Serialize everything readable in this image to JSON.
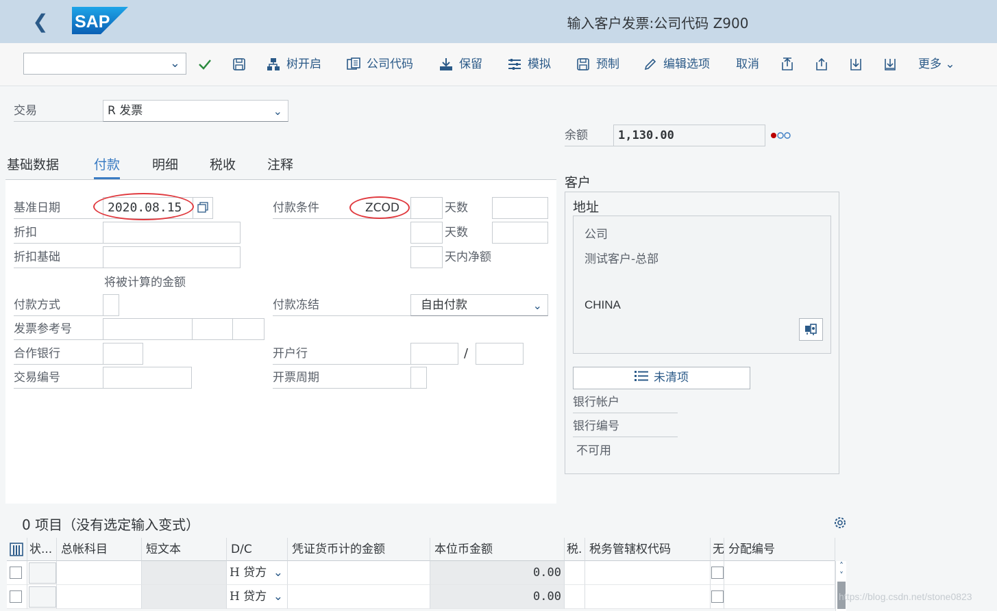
{
  "header": {
    "title": "输入客户发票:公司代码 Z900",
    "logo_text": "SAP"
  },
  "toolbar": {
    "dropdown_value": "",
    "tree_label": "树开启",
    "company_code_label": "公司代码",
    "hold_label": "保留",
    "simulate_label": "模拟",
    "park_label": "预制",
    "edit_options_label": "编辑选项",
    "cancel_label": "取消",
    "more_label": "更多"
  },
  "transaction": {
    "label": "交易",
    "value": "R 发票"
  },
  "balance": {
    "label": "余额",
    "value": "1,130.00"
  },
  "tabs": [
    {
      "label": "基础数据"
    },
    {
      "label": "付款"
    },
    {
      "label": "明细"
    },
    {
      "label": "税收"
    },
    {
      "label": "注释"
    }
  ],
  "payment": {
    "baseline_date_label": "基准日期",
    "baseline_date_value": "2020.08.15",
    "discount_label": "折扣",
    "discount_base_label": "折扣基础",
    "amount_to_calc": "将被计算的金额",
    "payment_method_label": "付款方式",
    "invoice_ref_label": "发票参考号",
    "partner_bank_label": "合作银行",
    "transaction_no_label": "交易编号",
    "payment_terms_label": "付款条件",
    "payment_terms_value": "ZCOD",
    "days_label_1": "天数",
    "days_label_2": "天数",
    "net_days_label": "天内净额",
    "payment_block_label": "付款冻结",
    "payment_block_value": "自由付款",
    "house_bank_label": "开户行",
    "slash": "/",
    "invoice_cycle_label": "开票周期"
  },
  "customer": {
    "section_label": "客户",
    "address_label": "地址",
    "line1": "公司",
    "line2": "测试客户-总部",
    "country": "CHINA",
    "open_items_label": "未清项",
    "bank_account_label": "银行帐户",
    "bank_number_label": "银行编号",
    "unavailable_label": "不可用"
  },
  "items": {
    "title": "0 项目（没有选定输入变式）",
    "columns": [
      "状...",
      "总帐科目",
      "短文本",
      "D/C",
      "凭证货币计的金额",
      "本位币金额",
      "税.",
      "税务管辖权代码",
      "无",
      "分配编号"
    ],
    "rows": [
      {
        "dc": "H 贷方",
        "local_amount": "0.00"
      },
      {
        "dc": "H 贷方",
        "local_amount": "0.00"
      }
    ]
  },
  "watermark": "https://blog.csdn.net/stone0823",
  "colors": {
    "header_bg": "#c8d9e8",
    "accent": "#3a7cc3",
    "highlight_oval": "#e0393e",
    "status_red": "#bb0000"
  }
}
